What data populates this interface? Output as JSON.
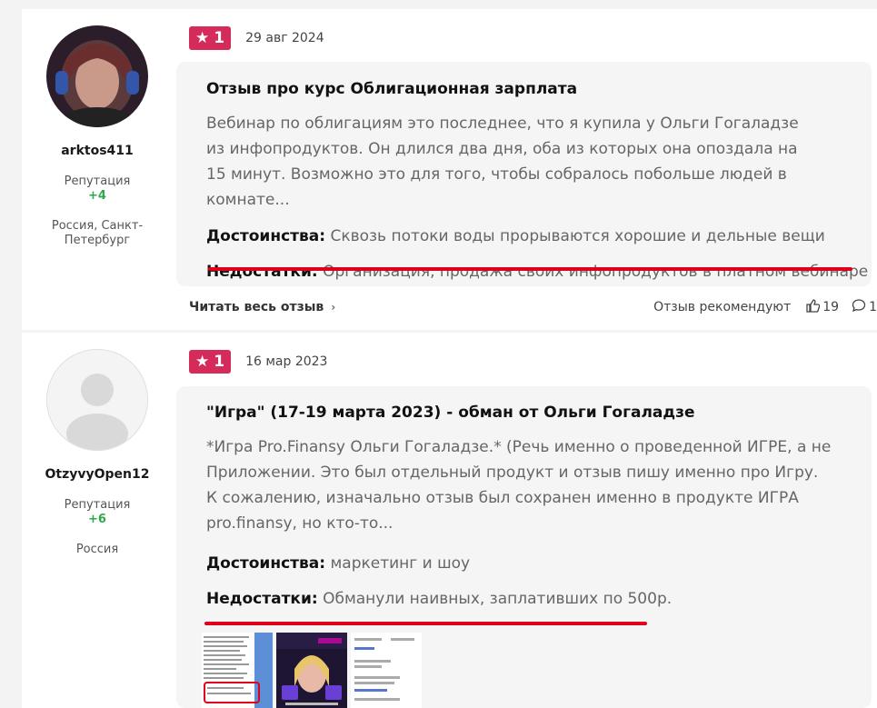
{
  "reviews": [
    {
      "user": {
        "name": "arktos411",
        "rep_label": "Репутация",
        "rep_value": "+4",
        "location": "Россия, Санкт-Петербург"
      },
      "rating": "1",
      "date": "29 авг 2024",
      "title": "Отзыв про курс Облигационная зарплата",
      "text": "Вебинар по облигациям это последнее, что я купила у Ольги Гогаладзе из инфопродуктов. Он длился два дня, оба из которых она опоздала на 15 минут. Возможно это для того, чтобы собралось побольше людей в комнате...",
      "pros_label": "Достоинства:",
      "pros": "Сквозь потоки воды прорываются хорошие и дельные вещи",
      "cons_label": "Недостатки:",
      "cons": "Организация, продажа своих инфопродуктов в платном вебинаре",
      "read_more": "Читать весь отзыв",
      "recommend": "Отзыв рекомендуют",
      "likes": "19",
      "comments": "1"
    },
    {
      "user": {
        "name": "OtzyvyOpen12",
        "rep_label": "Репутация",
        "rep_value": "+6",
        "location": "Россия"
      },
      "rating": "1",
      "date": "16 мар 2023",
      "title": "\"Игра\" (17-19 марта 2023) - обман от Ольги Гогаладзе",
      "text": "*Игра Pro.Finansy Ольги Гогаладзе.* (Речь именно о проведенной ИГРЕ, а не Приложении. Это был отдельный продукт и отзыв пишу именно про Игру. К сожалению, изначально отзыв был сохранен именно в продукте ИГРА pro.finansy, но кто-то...",
      "pros_label": "Достоинства:",
      "pros": "маркетинг и шоу",
      "cons_label": "Недостатки:",
      "cons": "Обманули наивных, заплативших по 500р."
    }
  ],
  "colors": {
    "badge": "#d52b5b",
    "underline": "#e0001a",
    "reputation": "#2ea84a"
  }
}
